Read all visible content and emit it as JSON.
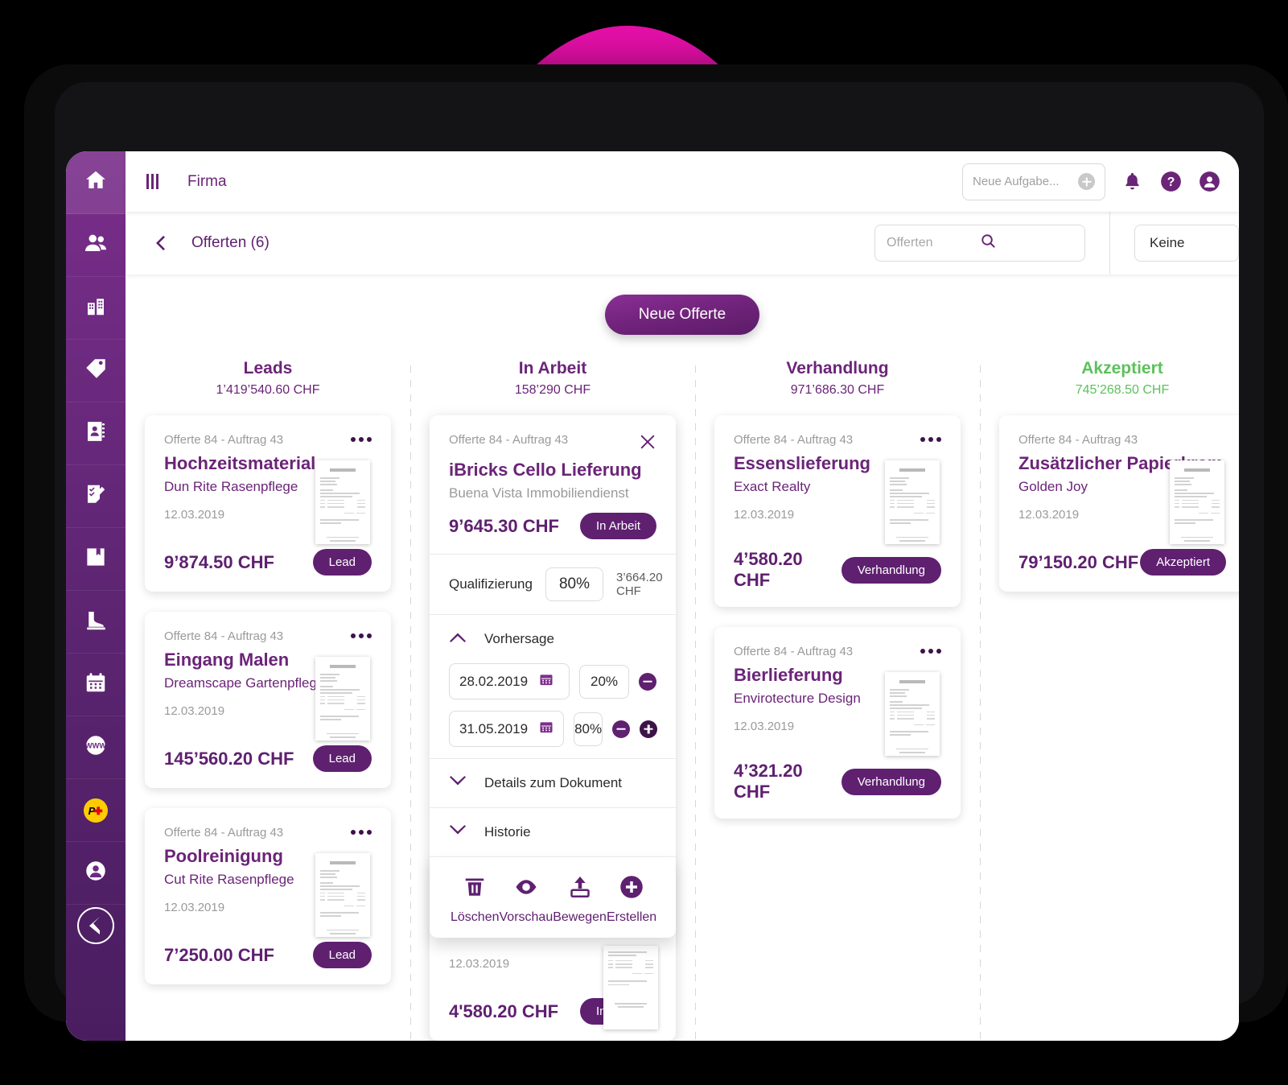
{
  "topbar": {
    "menu_icon": "hamburger-icon",
    "title": "Firma",
    "task_placeholder": "Neue Aufgabe...",
    "add_icon": "plus-circle-icon",
    "bell_icon": "bell-icon",
    "help_icon": "help-icon",
    "account_icon": "user-avatar-icon"
  },
  "subbar": {
    "back_icon": "chevron-left-icon",
    "title": "Offerten (6)",
    "search_placeholder": "Offerten",
    "search_icon": "search-icon",
    "filter_value": "Keine"
  },
  "board": {
    "new_offer_label": "Neue Offerte",
    "columns": [
      {
        "name": "Leads",
        "total": "1’419’540.60 CHF",
        "accent": "#6b2478",
        "cards": [
          {
            "ref": "Offerte 84 - Auftrag 43",
            "title": "Hochzeitsmaterial",
            "company": "Dun Rite Rasenpflege",
            "date": "12.03.2019",
            "amount": "9’874.50 CHF",
            "status": "Lead"
          },
          {
            "ref": "Offerte 84 - Auftrag 43",
            "title": "Eingang Malen",
            "company": "Dreamscape Gartenpflege",
            "date": "12.03.2019",
            "amount": "145’560.20 CHF",
            "status": "Lead"
          },
          {
            "ref": "Offerte 84 - Auftrag 43",
            "title": "Poolreinigung",
            "company": "Cut Rite Rasenpflege",
            "date": "12.03.2019",
            "amount": "7’250.00 CHF",
            "status": "Lead"
          }
        ]
      },
      {
        "name": "In Arbeit",
        "total": "158’290 CHF",
        "accent": "#6b2478",
        "cards": []
      },
      {
        "name": "Verhandlung",
        "total": "971’686.30 CHF",
        "accent": "#6b2478",
        "cards": [
          {
            "ref": "Offerte 84 - Auftrag 43",
            "title": "Essenslieferung",
            "company": "Exact Realty",
            "date": "12.03.2019",
            "amount": "4’580.20 CHF",
            "status": "Verhandlung"
          },
          {
            "ref": "Offerte 84 - Auftrag 43",
            "title": "Bierlieferung",
            "company": "Envirotecture Design",
            "date": "12.03.2019",
            "amount": "4’321.20 CHF",
            "status": "Verhandlung"
          }
        ]
      },
      {
        "name": "Akzeptiert",
        "total": "745’268.50 CHF",
        "accent": "#5DC15B",
        "cards": [
          {
            "ref": "Offerte 84 - Auftrag 43",
            "title": "Zusätzlicher Papierkram",
            "company": "Golden Joy",
            "date": "12.03.2019",
            "amount": "79’150.20 CHF",
            "status": "Akzeptiert"
          }
        ]
      }
    ]
  },
  "expanded_card": {
    "ref": "Offerte 84 - Auftrag 43",
    "close_icon": "close-icon",
    "title": "iBricks Cello Lieferung",
    "company": "Buena Vista Immobiliendienst",
    "amount": "9’645.30 CHF",
    "status": "In Arbeit",
    "qualification_label": "Qualifizierung",
    "qualification_value": "80%",
    "qualification_amount": "3’664.20 CHF",
    "forecast_section": "Vorhersage",
    "forecast_rows": [
      {
        "date": "28.02.2019",
        "percent": "20%"
      },
      {
        "date": "31.05.2019",
        "percent": "80%"
      }
    ],
    "details_section": "Details zum Dokument",
    "history_section": "Historie",
    "actions": [
      {
        "label": "Löschen",
        "icon": "trash-icon"
      },
      {
        "label": "Vorschau",
        "icon": "eye-icon"
      },
      {
        "label": "Bewegen",
        "icon": "move-upload-icon"
      },
      {
        "label": "Erstellen",
        "icon": "plus-circle-icon"
      }
    ],
    "tail": {
      "date": "12.03.2019",
      "amount": "4'580.20 CHF",
      "status": "In Arbeit"
    }
  },
  "sidebar": {
    "items": [
      {
        "icon": "home-icon",
        "active": true
      },
      {
        "icon": "people-icon",
        "active": false
      },
      {
        "icon": "building-icon",
        "active": false
      },
      {
        "icon": "tag-icon",
        "active": false
      },
      {
        "icon": "address-book-icon",
        "active": false
      },
      {
        "icon": "checklist-edit-icon",
        "active": false
      },
      {
        "icon": "book-bookmark-icon",
        "active": false
      },
      {
        "icon": "boot-icon",
        "active": false
      },
      {
        "icon": "calendar-icon",
        "active": false
      },
      {
        "icon": "www-globe-icon",
        "active": false
      },
      {
        "icon": "postfinance-icon",
        "active": false,
        "badge_text": "P"
      },
      {
        "icon": "user-circle-icon",
        "active": false
      }
    ],
    "logo_icon": "ibricks-logo-icon"
  }
}
